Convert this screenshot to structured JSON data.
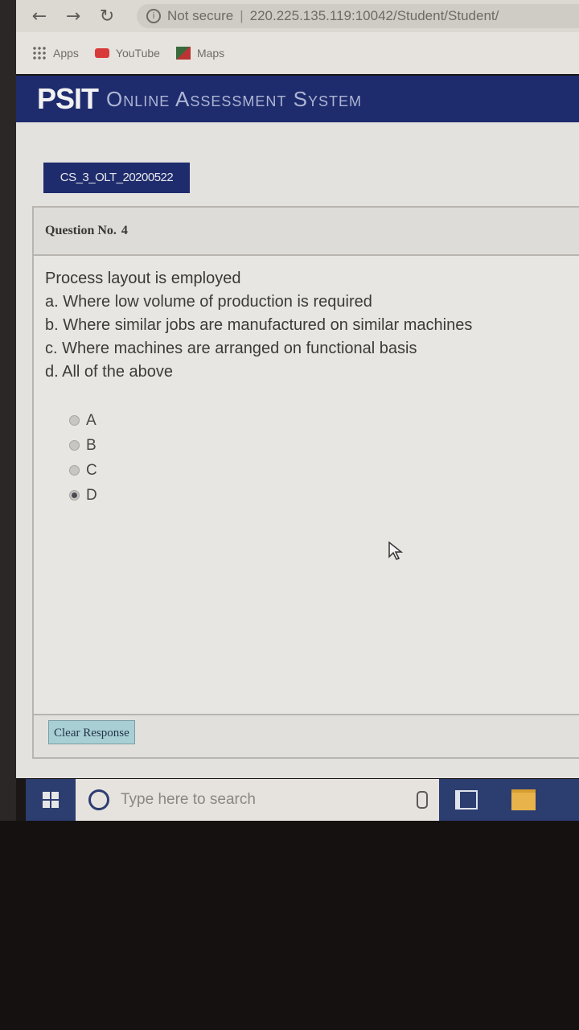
{
  "browser": {
    "security_label": "Not secure",
    "url": "220.225.135.119:10042/Student/Student/",
    "bookmarks": [
      "Apps",
      "YouTube",
      "Maps"
    ]
  },
  "app": {
    "logo": "PSIT",
    "system_name": "Online Assessment System"
  },
  "test": {
    "code": "CS_3_OLT_20200522"
  },
  "question": {
    "header_label": "Question No.",
    "number": "4",
    "text": "Process layout is employed",
    "options": [
      "a. Where low volume of production is required",
      "b. Where similar jobs are manufactured on similar machines",
      "c. Where machines are arranged on functional basis",
      "d. All of the above"
    ],
    "choices": [
      "A",
      "B",
      "C",
      "D"
    ],
    "selected": "D",
    "clear_label": "Clear Response"
  },
  "taskbar": {
    "search_placeholder": "Type here to search"
  }
}
